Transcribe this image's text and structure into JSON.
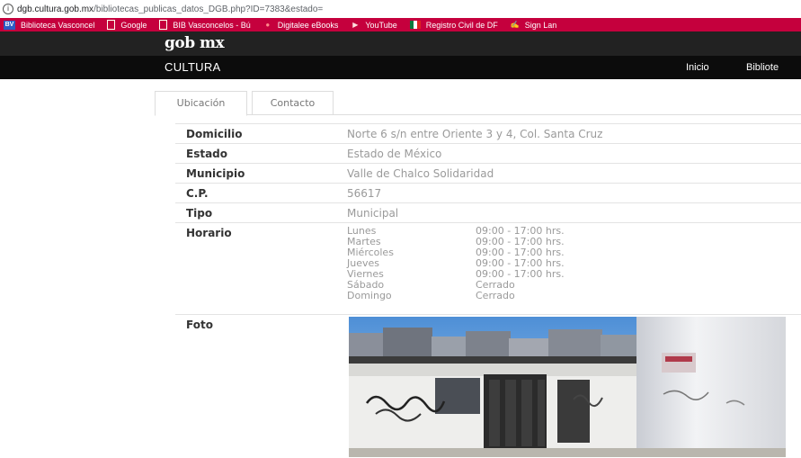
{
  "browser": {
    "url_host": "dgb.cultura.gob.mx",
    "url_path": "/bibliotecas_publicas_datos_DGB.php?ID=7383&estado=",
    "bookmarks": [
      {
        "label": "Biblioteca Vasconcel",
        "icon": "bv-icon"
      },
      {
        "label": "Google",
        "icon": "document-icon"
      },
      {
        "label": "BIB Vasconcelos - Bú",
        "icon": "document-icon"
      },
      {
        "label": "Digitalee eBooks",
        "icon": "dot-icon"
      },
      {
        "label": "YouTube",
        "icon": "youtube-icon"
      },
      {
        "label": "Registro Civil de DF",
        "icon": "flag-icon"
      },
      {
        "label": "Sign Lan",
        "icon": "sign-icon"
      }
    ]
  },
  "header": {
    "logo": "gob mx",
    "brand": "CULTURA",
    "nav_links": [
      "Inicio",
      "Bibliote"
    ]
  },
  "tabs": [
    "Ubicación",
    "Contacto"
  ],
  "details": {
    "domicilio_label": "Domicilio",
    "domicilio_value": "Norte 6 s/n entre Oriente 3 y 4, Col. Santa Cruz",
    "estado_label": "Estado",
    "estado_value": "Estado de México",
    "municipio_label": "Municipio",
    "municipio_value": "Valle de Chalco Solidaridad",
    "cp_label": "C.P.",
    "cp_value": "56617",
    "tipo_label": "Tipo",
    "tipo_value": "Municipal",
    "horario_label": "Horario",
    "horario": [
      {
        "day": "Lunes",
        "hours": "09:00 - 17:00 hrs."
      },
      {
        "day": "Martes",
        "hours": "09:00 - 17:00 hrs."
      },
      {
        "day": "Miércoles",
        "hours": "09:00 - 17:00 hrs."
      },
      {
        "day": "Jueves",
        "hours": "09:00 - 17:00 hrs."
      },
      {
        "day": "Viernes",
        "hours": "09:00 - 17:00 hrs."
      },
      {
        "day": "Sábado",
        "hours": "Cerrado"
      },
      {
        "day": "Domingo",
        "hours": "Cerrado"
      }
    ],
    "foto_label": "Foto"
  },
  "colors": {
    "bookmark_bar": "#c5003d",
    "header_dark": "#222222",
    "nav_dark": "#0c0c0c"
  }
}
